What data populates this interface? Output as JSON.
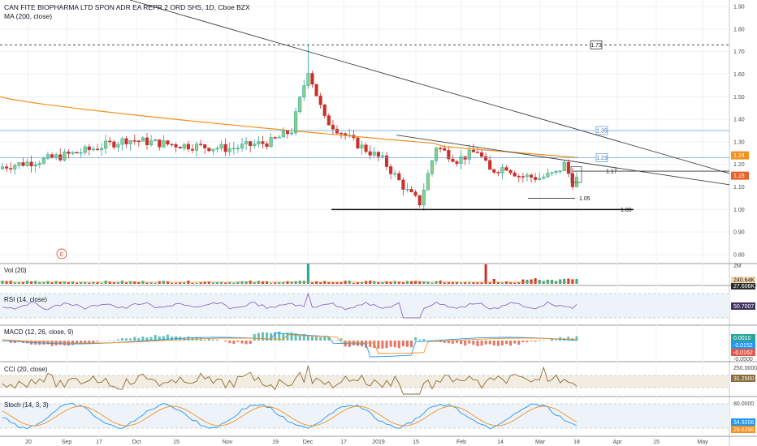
{
  "header": {
    "title": "CAN FITE BIOPHARMA LTD SPON ADR EA REPR 2 ORD SHS, 1D, Cboe BZX",
    "ma_label": "MA (200, close)"
  },
  "colors": {
    "up": "#26a69a",
    "down": "#c9302c",
    "candle_up_fill": "#8ccf88",
    "ma": "#f3911f",
    "hline_blue": "#6a9fd4",
    "trend": "#404040",
    "last_price_bg": "#e8642c",
    "ma_tag_bg": "#f3911f",
    "rsi": "#8e6cc0",
    "macd": "#2196f3",
    "signal": "#f3911f",
    "cci": "#8a6d3b",
    "stoch_k": "#2196f3",
    "stoch_d": "#f3911f",
    "band_fill": "#f3ece0"
  },
  "chart_data": {
    "type": "candlestick",
    "price_axis": {
      "ticks": [
        "1.90",
        "1.80",
        "1.70",
        "1.60",
        "1.50",
        "1.40",
        "1.30",
        "1.20",
        "1.10",
        "1.00",
        "0.90",
        "0.80"
      ],
      "range": [
        0.77,
        1.93
      ]
    },
    "time_axis": {
      "labels": [
        "20",
        "Sep",
        "17",
        "Oct",
        "15",
        "Nov",
        "19",
        "Dec",
        "17",
        "2019",
        "15",
        "Feb",
        "14",
        "Mar",
        "18",
        "Apr",
        "15",
        "May"
      ]
    },
    "horizontal_levels": [
      {
        "label": "1.73",
        "value": 1.73,
        "style": "dashed",
        "boxed": true
      },
      {
        "label": "1.35",
        "value": 1.35,
        "style": "blue",
        "boxed": true
      },
      {
        "label": "1.23",
        "value": 1.23,
        "style": "blue",
        "boxed": true
      },
      {
        "label": "1.17",
        "value": 1.17,
        "style": "black"
      },
      {
        "label": "1.05",
        "value": 1.05,
        "style": "black-short"
      },
      {
        "label": "1.00",
        "value": 1.0,
        "style": "black-thick"
      }
    ],
    "price_tags": [
      {
        "label": "1.24",
        "value": 1.24,
        "kind": "ma"
      },
      {
        "label": "1.15",
        "value": 1.15,
        "kind": "last"
      }
    ],
    "event_marker": "E",
    "volume": {
      "title": "Vol (20)",
      "axis_label": "2M",
      "tags": [
        "240.64K",
        "27.606K"
      ]
    },
    "rsi": {
      "title": "RSI (14, close)",
      "tag": "50.7007"
    },
    "macd": {
      "title": "MACD (12, 26, close, 9)",
      "axis_label": "-0.0500",
      "tags": [
        "0.0010",
        "-0.0152",
        "-0.0162"
      ]
    },
    "cci": {
      "title": "CCI (20, close)",
      "axis_label": "250.0000",
      "tag": "31.2500"
    },
    "stoch": {
      "title": "Stoch (14, 3, 3)",
      "axis_label": "80.0000",
      "tags": [
        "34.9206",
        "29.6296"
      ]
    }
  }
}
